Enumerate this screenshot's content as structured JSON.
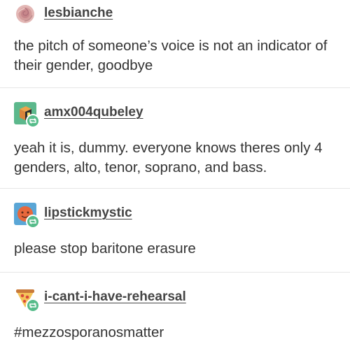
{
  "thread": [
    {
      "username": "lesbianche",
      "avatar_icon": "rose-avatar-icon",
      "reblog_badge": false,
      "body": "the pitch of someone’s voice is not an indicator of their gender, goodbye"
    },
    {
      "username": "amx004qubeley",
      "avatar_icon": "cube-avatar-icon",
      "reblog_badge": true,
      "body": "yeah it is, dummy. everyone knows theres only 4 genders, alto, tenor, soprano, and bass."
    },
    {
      "username": "lipstickmystic",
      "avatar_icon": "orange-face-avatar-icon",
      "reblog_badge": true,
      "body": "please stop baritone erasure"
    },
    {
      "username": "i-cant-i-have-rehearsal",
      "avatar_icon": "pizza-slice-avatar-icon",
      "reblog_badge": true,
      "body": "#mezzosporanosmatter"
    }
  ],
  "colors": {
    "reblog_badge": "#56bc8a",
    "divider": "#e6e6e6",
    "text": "#333333"
  }
}
